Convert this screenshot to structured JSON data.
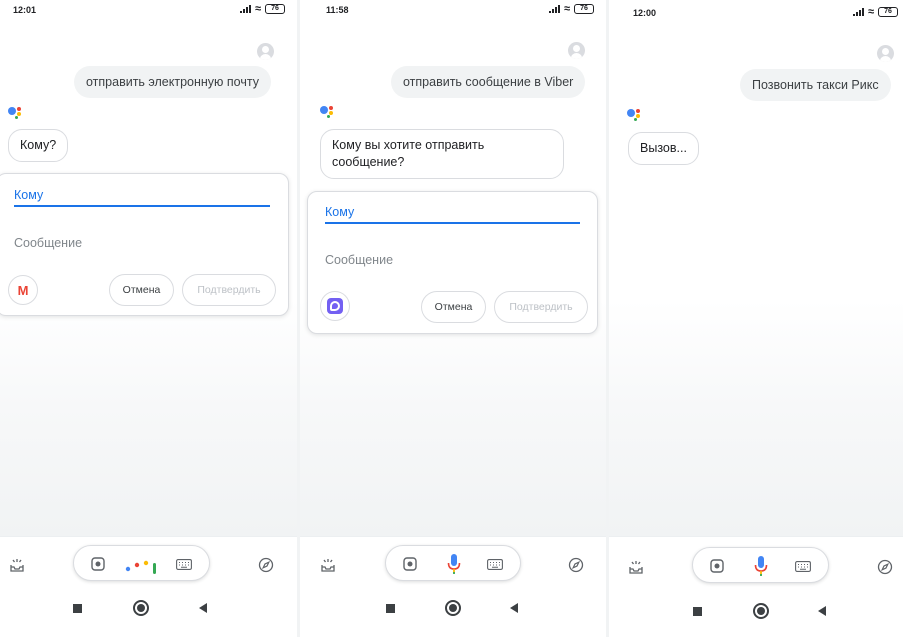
{
  "screens": [
    {
      "status": {
        "time": "12:01",
        "battery": "76"
      },
      "user_query": "отправить электронную почту",
      "assistant_reply": "Кому?",
      "card": {
        "to_label": "Кому",
        "message_label": "Сообщение",
        "app_icon": "gmail-icon",
        "cancel_label": "Отмена",
        "confirm_label": "Подтвердить"
      },
      "input_mode": "listening-dots"
    },
    {
      "status": {
        "time": "11:58",
        "battery": "76"
      },
      "user_query": "отправить сообщение в Viber",
      "assistant_reply": "Кому вы хотите отправить сообщение?",
      "card": {
        "to_label": "Кому",
        "message_label": "Сообщение",
        "app_icon": "viber-icon",
        "cancel_label": "Отмена",
        "confirm_label": "Подтвердить"
      },
      "input_mode": "mic"
    },
    {
      "status": {
        "time": "12:00",
        "battery": "76"
      },
      "user_query": "Позвонить такси Рикс",
      "assistant_reply": "Вызов...",
      "input_mode": "mic"
    }
  ],
  "colors": {
    "accent": "#1a73e8",
    "google_blue": "#4285f4",
    "google_red": "#ea4335",
    "google_yellow": "#fbbc05",
    "google_green": "#34a853",
    "viber_purple": "#7360f2"
  }
}
